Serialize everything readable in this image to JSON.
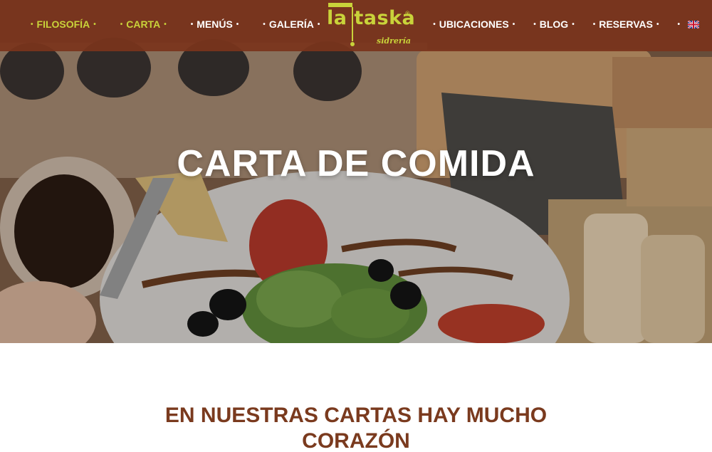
{
  "header": {
    "nav_left": [
      {
        "label": "FILOSOFÍA",
        "active": true
      },
      {
        "label": "CARTA",
        "active": true
      },
      {
        "label": "MENÚS",
        "active": false
      },
      {
        "label": "GALERÍA",
        "active": false
      }
    ],
    "nav_right": [
      {
        "label": "UBICACIONES"
      },
      {
        "label": "BLOG"
      },
      {
        "label": "RESERVAS"
      }
    ],
    "separator": "•",
    "logo": {
      "main": "la taska",
      "sub": "sidrería",
      "reg": "®"
    },
    "language_flag": "uk-flag-icon"
  },
  "hero": {
    "title": "CARTA DE COMIDA"
  },
  "content": {
    "heading": "EN NUESTRAS CARTAS HAY MUCHO CORAZÓN"
  },
  "colors": {
    "header_bg": "#7a341c",
    "accent": "#c9d33a",
    "heading": "#7a3a1e"
  }
}
